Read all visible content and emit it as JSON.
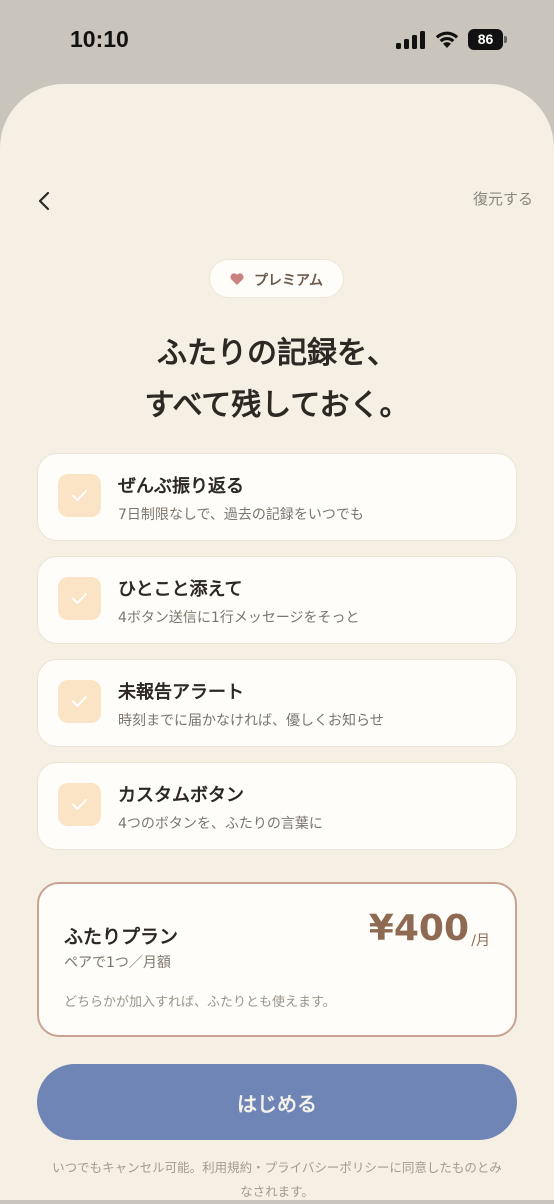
{
  "status_bar": {
    "time": "10:10",
    "battery": "86"
  },
  "nav": {
    "restore_label": "復元する"
  },
  "badge": {
    "label": "プレミアム",
    "heart_color": "#c9827f"
  },
  "headline": {
    "line1": "ふたりの記録を、",
    "line2": "すべて残しておく。"
  },
  "features": [
    {
      "title": "ぜんぶ振り返る",
      "description": "7日制限なしで、過去の記録をいつでも"
    },
    {
      "title": "ひとこと添えて",
      "description": "4ボタン送信に1行メッセージをそっと"
    },
    {
      "title": "未報告アラート",
      "description": "時刻までに届かなければ、優しくお知らせ"
    },
    {
      "title": "カスタムボタン",
      "description": "4つのボタンを、ふたりの言葉に"
    }
  ],
  "plan": {
    "name": "ふたりプラン",
    "subtitle": "ペアで1つ／月額",
    "price": "¥400",
    "unit": "/月",
    "note": "どちらかが加入すれば、ふたりとも使えます。"
  },
  "cta": {
    "label": "はじめる"
  },
  "footer": {
    "line1": "いつでもキャンセル可能。利用規約・プライバシーポリシーに同意したものとみ",
    "line2": "なされます。"
  },
  "colors": {
    "background": "#f6efe4",
    "accent_button": "#6f85b6",
    "price": "#8e6a52",
    "plan_border": "#c8a393",
    "check_box": "#fbe3c6"
  }
}
